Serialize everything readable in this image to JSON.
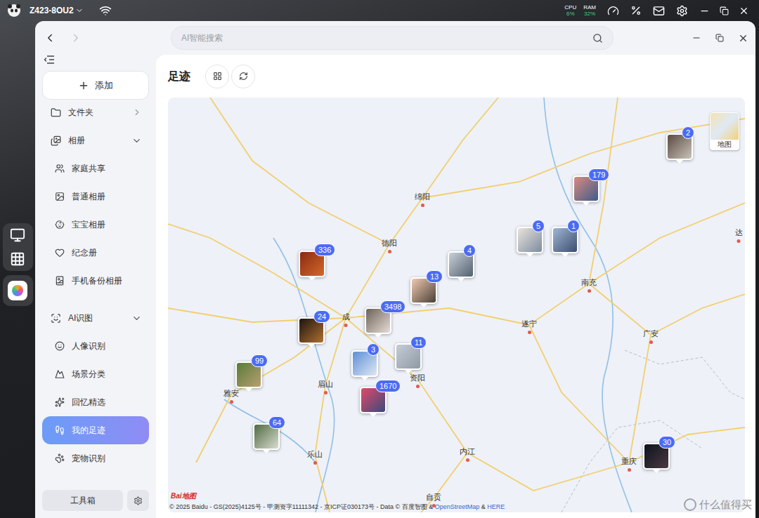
{
  "topbar": {
    "device": "Z423-8OU2",
    "cpu": {
      "label": "CPU",
      "value": "6%"
    },
    "ram": {
      "label": "RAM",
      "value": "32%"
    }
  },
  "window": {
    "search_placeholder": "AI智能搜索",
    "back_enabled": true,
    "forward_enabled": false
  },
  "sidebar": {
    "add_button": "添加",
    "groups": [
      {
        "label": "文件夹",
        "expanded": false,
        "items": []
      },
      {
        "label": "相册",
        "expanded": true,
        "items": [
          {
            "label": "家庭共享",
            "selected": false
          },
          {
            "label": "普通相册",
            "selected": false
          },
          {
            "label": "宝宝相册",
            "selected": false
          },
          {
            "label": "纪念册",
            "selected": false
          },
          {
            "label": "手机备份相册",
            "selected": false
          }
        ]
      },
      {
        "label": "AI识图",
        "expanded": true,
        "items": [
          {
            "label": "人像识别",
            "selected": false
          },
          {
            "label": "场景分类",
            "selected": false
          },
          {
            "label": "回忆精选",
            "selected": false
          },
          {
            "label": "我的足迹",
            "selected": true
          },
          {
            "label": "宠物识别",
            "selected": false
          }
        ]
      }
    ],
    "toolbox": "工具箱"
  },
  "content": {
    "title": "足迹"
  },
  "map": {
    "cities": [
      {
        "name": "绵阳"
      },
      {
        "name": "德阳"
      },
      {
        "name": "成"
      },
      {
        "name": "南充"
      },
      {
        "name": "遂宁"
      },
      {
        "name": "广安"
      },
      {
        "name": "雅安"
      },
      {
        "name": "眉山"
      },
      {
        "name": "资阳"
      },
      {
        "name": "乐山"
      },
      {
        "name": "内江"
      },
      {
        "name": "重庆"
      },
      {
        "name": "自贡"
      },
      {
        "name": "达"
      }
    ],
    "pins": [
      {
        "count": "2"
      },
      {
        "count": "179"
      },
      {
        "count": "5"
      },
      {
        "count": "1"
      },
      {
        "count": "336"
      },
      {
        "count": "4"
      },
      {
        "count": "13"
      },
      {
        "count": "3498"
      },
      {
        "count": "24"
      },
      {
        "count": "11"
      },
      {
        "count": "3"
      },
      {
        "count": "99"
      },
      {
        "count": "1670"
      },
      {
        "count": "64"
      },
      {
        "count": "30"
      }
    ],
    "layer_toggle": "地图",
    "logo": "Bai地图",
    "attribution": {
      "text": "© 2025 Baidu - GS(2025)4125号 - 甲测资字11111342 - 京ICP证030173号 - Data © 百度智图 & ",
      "link1": "OpenStreetMap",
      "sep": " & ",
      "link2": "HERE"
    }
  },
  "watermark": "什么值得买"
}
